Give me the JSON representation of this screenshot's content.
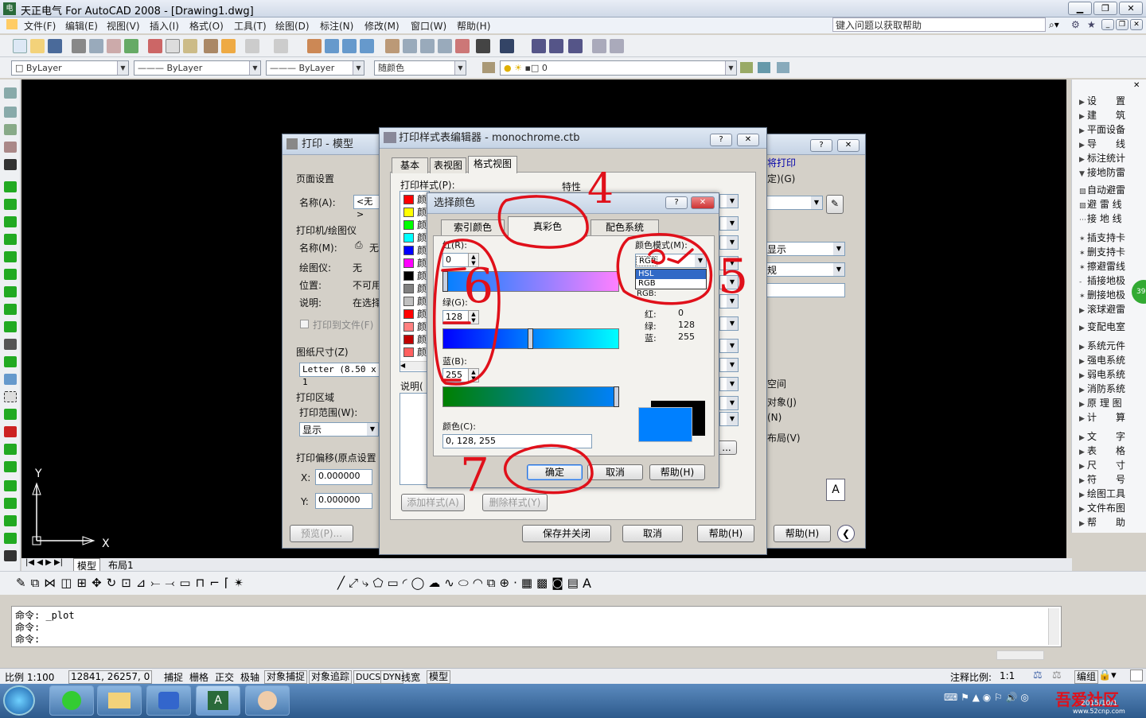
{
  "app": {
    "title": "天正电气 For AutoCAD 2008 - [Drawing1.dwg]",
    "help_placeholder": "键入问题以获取帮助",
    "menu": [
      "文件(F)",
      "编辑(E)",
      "视图(V)",
      "插入(I)",
      "格式(O)",
      "工具(T)",
      "绘图(D)",
      "标注(N)",
      "修改(M)",
      "窗口(W)",
      "帮助(H)"
    ],
    "layer_combo_1": "ByLayer",
    "layer_combo_2": "ByLayer",
    "layer_combo_3": "ByLayer",
    "color_combo": "随颜色",
    "layer_value": "0"
  },
  "right_panel": [
    "设　　置",
    "建　　筑",
    "平面设备",
    "导　　线",
    "标注统计",
    "接地防雷",
    "自动避雷",
    "避 雷 线",
    "接 地 线",
    "插支持卡",
    "删支持卡",
    "擦避雷线",
    "插接地极",
    "删接地极",
    "滚球避雷",
    "变配电室",
    "系统元件",
    "强电系统",
    "弱电系统",
    "消防系统",
    "原 理 图",
    "计　　算",
    "文　　字",
    "表　　格",
    "尺　　寸",
    "符　　号",
    "绘图工具",
    "文件布图",
    "帮　　助"
  ],
  "layout_tabs": [
    "模型",
    "布局1"
  ],
  "command_lines": [
    "命令: _plot",
    "命令:",
    "命令:"
  ],
  "status": {
    "scale": "比例 1:100",
    "coords": "12841, 26257, 0",
    "toggles": [
      "捕捉",
      "栅格",
      "正交",
      "极轴",
      "对象捕捉",
      "对象追踪",
      "DUCS",
      "DYN",
      "线宽",
      "模型"
    ],
    "annotation_scale_label": "注释比例:",
    "annotation_scale": "1:1",
    "edit_label": "编组"
  },
  "print_dialog": {
    "title": "打印 - 模型",
    "page_setup": "页面设置",
    "name_label": "名称(A):",
    "name_value": "<无>",
    "printer_section": "打印机/绘图仪",
    "printer_name_label": "名称(M):",
    "printer_name_value": "无",
    "plotter_label": "绘图仪:",
    "plotter_value": "无",
    "location_label": "位置:",
    "location_value": "不可用",
    "desc_label": "说明:",
    "desc_value": "在选择",
    "print_to_file": "打印到文件(F)",
    "paper_size_label": "图纸尺寸(Z)",
    "paper_size_value": "Letter (8.50 x 1",
    "print_area": "打印区域",
    "print_range_label": "打印范围(W):",
    "print_range_value": "显示",
    "offset_label": "打印偏移(原点设置",
    "x_label": "X:",
    "x_value": "0.000000",
    "y_label": "Y:",
    "y_value": "0.000000",
    "preview_btn": "预览(P)...",
    "help_btn": "帮助(H)",
    "right_fragment_1": "将打印",
    "right_fragment_2": "定)(G)",
    "right_fragment_3": "显示",
    "right_fragment_4": "规",
    "right_fragment_5": "空间",
    "right_fragment_6": "对象(J)",
    "right_fragment_7": "(N)",
    "right_fragment_8": "布局(V)"
  },
  "style_editor": {
    "title": "打印样式表编辑器 - monochrome.ctb",
    "tabs": [
      "基本",
      "表视图",
      "格式视图"
    ],
    "styles_label": "打印样式(P):",
    "props_label": "特性",
    "style_item": "颜",
    "desc_label": "说明(",
    "add_style": "添加样式(A)",
    "delete_style": "删除样式(Y)",
    "save_close": "保存并关闭",
    "cancel": "取消",
    "help": "帮助(H)",
    "swatch_colors": [
      "#ff0000",
      "#ffff00",
      "#00ff00",
      "#00ffff",
      "#0000ff",
      "#ff00ff",
      "#000000",
      "#808080",
      "#c0c0c0",
      "#ff0000",
      "#ff8080",
      "#c00000",
      "#ff6060"
    ]
  },
  "color_dialog": {
    "title": "选择颜色",
    "tabs": [
      "索引颜色",
      "真彩色",
      "配色系统"
    ],
    "red_label": "红(R):",
    "red_value": "0",
    "green_label": "绿(G):",
    "green_value": "128",
    "blue_label": "蓝(B):",
    "blue_value": "255",
    "mode_label": "颜色模式(M):",
    "mode_value": "RGB",
    "mode_options": [
      "HSL",
      "RGB"
    ],
    "rgb_readout": "RGB:",
    "r_text": "红:",
    "r_num": "0",
    "g_text": "绿:",
    "g_num": "128",
    "b_text": "蓝:",
    "b_num": "255",
    "color_label": "颜色(C):",
    "color_value": "0, 128, 255",
    "ok": "确定",
    "cancel": "取消",
    "help": "帮助(H)",
    "old_color": "#000000",
    "new_color": "#0080ff"
  },
  "annotations": {
    "color": "#e0101a",
    "numbers": [
      "4",
      "5",
      "6",
      "7"
    ]
  },
  "watermark": {
    "site": "吾爱社区",
    "url": "www.52cnp.com",
    "date": "2015/10/1"
  }
}
